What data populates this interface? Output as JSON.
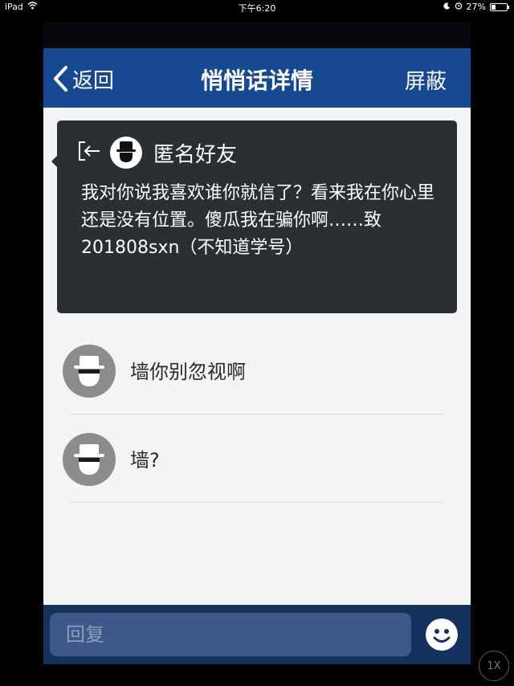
{
  "status_bar": {
    "device": "iPad",
    "time": "下午6:20",
    "battery": "27%",
    "battery_level": 0.27
  },
  "nav": {
    "back_label": "返回",
    "title": "悄悄话详情",
    "block_label": "屏蔽"
  },
  "message": {
    "sender": "匿名好友",
    "text": "我对你说我喜欢谁你就信了？看来我在你心里还是没有位置。傻瓜我在骗你啊……致201808sxn（不知道学号）"
  },
  "replies": [
    {
      "text": "墙你别忽视啊"
    },
    {
      "text": "墙?"
    }
  ],
  "input": {
    "placeholder": "回复"
  },
  "speed_badge": "1X",
  "icons": {
    "back": "chevron-left-icon",
    "exit": "exit-icon",
    "avatar": "anonymous-hat-avatar-icon",
    "emoji": "smiley-icon",
    "wifi": "wifi-icon",
    "moon": "moon-icon",
    "alarm": "alarm-icon",
    "battery": "battery-icon"
  },
  "colors": {
    "nav_background": "#174993",
    "card_background": "#2b2e33",
    "page_background": "#f3f4f6",
    "input_bar": "#15315e",
    "input_field": "#3d5889"
  }
}
